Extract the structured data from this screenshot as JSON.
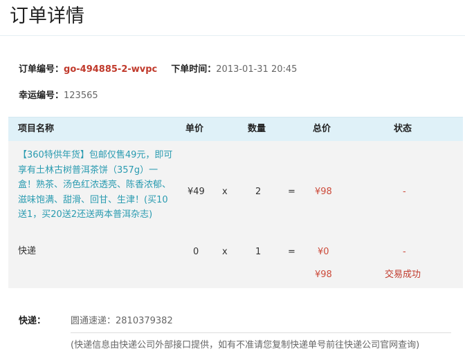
{
  "header": {
    "title": "订单详情"
  },
  "order": {
    "order_no_label": "订单编号：",
    "order_no": "go-494885-2-wvpc",
    "order_time_label": "下单时间：",
    "order_time": "2013-01-31 20:45",
    "lucky_no_label": "幸运编号：",
    "lucky_no": "123565"
  },
  "table": {
    "columns": [
      "项目名称",
      "单价",
      "数量",
      "总价",
      "状态"
    ],
    "rows": [
      {
        "name": "【360特供年货】包邮仅售49元，即可享有土林古树普洱茶饼（357g）一盒！熟茶、汤色红浓透亮、陈香浓郁、滋味饱满、甜滑、回甘、生津！(买10送1，买20送2还送两本普洱杂志)",
        "unit_price": "¥49",
        "times": "x",
        "quantity": "2",
        "equals": "=",
        "total": "¥98",
        "status": "-"
      },
      {
        "name": "快递",
        "unit_price": "0",
        "times": "x",
        "quantity": "1",
        "equals": "=",
        "total": "¥0",
        "status": "-"
      }
    ],
    "summary": {
      "total": "¥98",
      "status": "交易成功"
    }
  },
  "shipping": {
    "label": "快递：",
    "carrier": "圆通速递：2810379382",
    "note": "(快递信息由快递公司外部接口提供，如有不准请您复制快递单号前往快递公司官网查询)"
  },
  "colors": {
    "accent_red": "#c0392b",
    "link_teal": "#2a9bb0",
    "header_blue": "#dff1f8",
    "body_gray": "#f3f3f3"
  }
}
